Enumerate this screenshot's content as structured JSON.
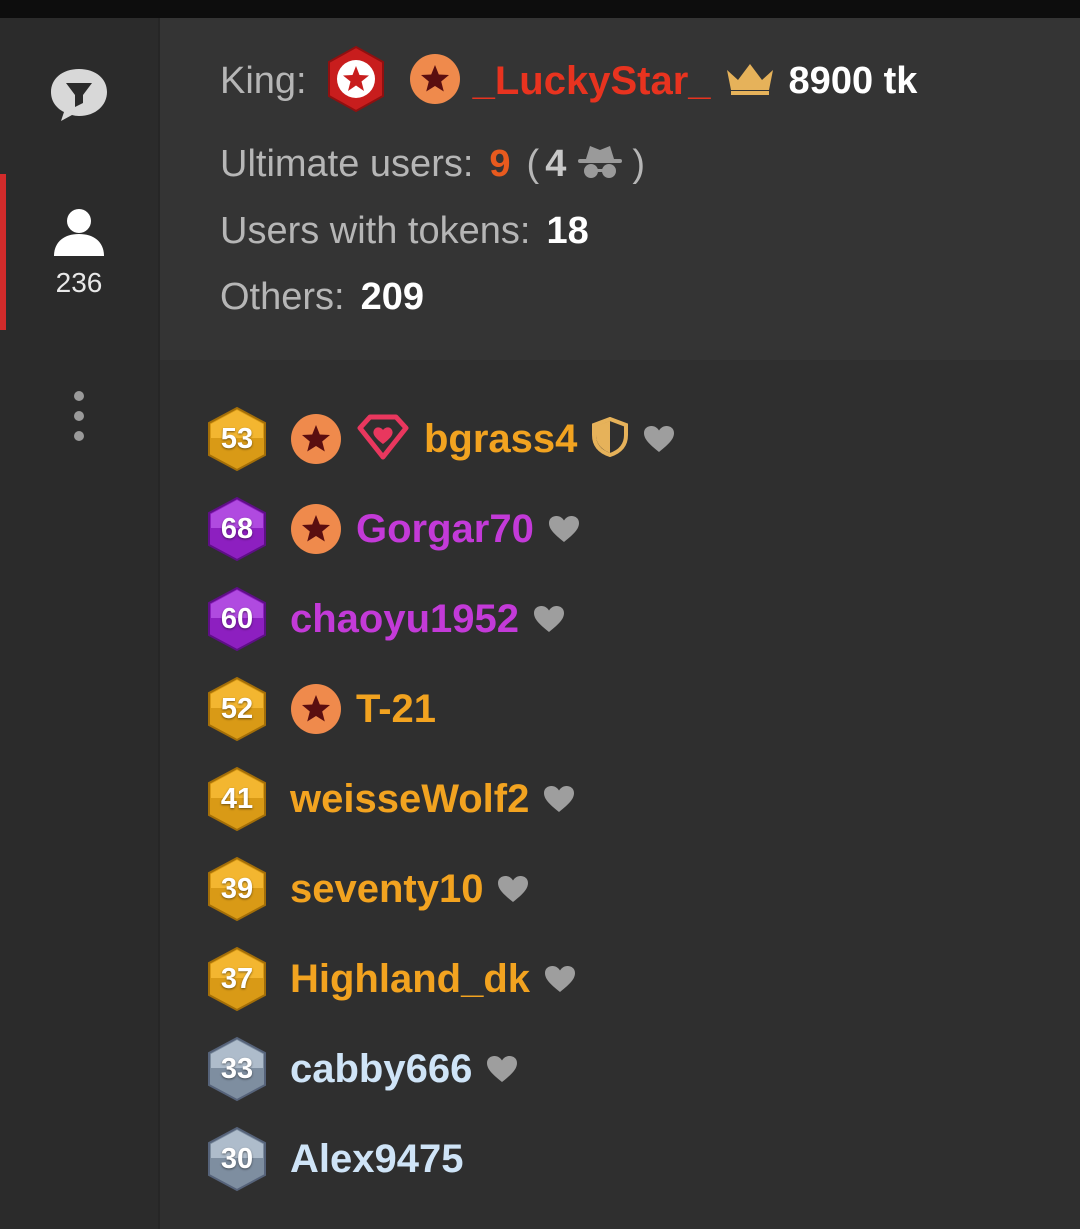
{
  "sidebar": {
    "user_count": "236"
  },
  "summary": {
    "king_label": "King:",
    "king_name": "_LuckyStar_",
    "king_tokens": "8900 tk",
    "ultimate_label": "Ultimate users:",
    "ultimate_count": "9",
    "ultimate_open": "(",
    "ultimate_incognito": "4",
    "ultimate_close": ")",
    "tokens_label": "Users with tokens:",
    "tokens_count": "18",
    "others_label": "Others:",
    "others_count": "209"
  },
  "users": [
    {
      "level": "53",
      "name": "bgrass4",
      "tier": "gold",
      "star": true,
      "gem": true,
      "shield": true,
      "heart": true
    },
    {
      "level": "68",
      "name": "Gorgar70",
      "tier": "purple",
      "star": true,
      "gem": false,
      "shield": false,
      "heart": true
    },
    {
      "level": "60",
      "name": "chaoyu1952",
      "tier": "purple",
      "star": false,
      "gem": false,
      "shield": false,
      "heart": true
    },
    {
      "level": "52",
      "name": "T-21",
      "tier": "gold",
      "star": true,
      "gem": false,
      "shield": false,
      "heart": false
    },
    {
      "level": "41",
      "name": "weisseWolf2",
      "tier": "gold",
      "star": false,
      "gem": false,
      "shield": false,
      "heart": true
    },
    {
      "level": "39",
      "name": "seventy10",
      "tier": "gold",
      "star": false,
      "gem": false,
      "shield": false,
      "heart": true
    },
    {
      "level": "37",
      "name": "Highland_dk",
      "tier": "gold",
      "star": false,
      "gem": false,
      "shield": false,
      "heart": true
    },
    {
      "level": "33",
      "name": "cabby666",
      "tier": "silver",
      "star": false,
      "gem": false,
      "shield": false,
      "heart": true
    },
    {
      "level": "30",
      "name": "Alex9475",
      "tier": "silver",
      "star": false,
      "gem": false,
      "shield": false,
      "heart": false
    }
  ],
  "colors": {
    "accent_red": "#d22b2b",
    "king_name": "#e8331f",
    "gold_user": "#f2a320",
    "purple_user": "#c33ad8",
    "silver_user": "#cfe4f7",
    "ultimate_count": "#e85a1e"
  },
  "icons": {
    "chat": "chat-filter-icon",
    "users": "user-icon",
    "more": "more-vertical-icon",
    "king_badge": "red-star-hex-icon",
    "star_badge": "star-badge-icon",
    "crown": "crown-icon",
    "incognito": "incognito-icon",
    "gem": "gem-heart-icon",
    "shield": "shield-icon",
    "heart": "heart-icon"
  }
}
